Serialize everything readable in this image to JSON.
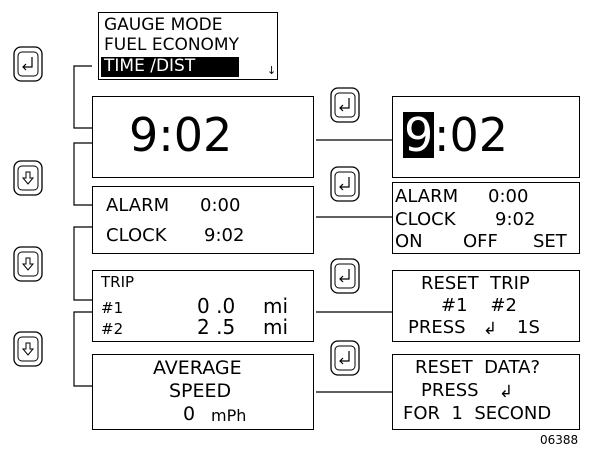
{
  "menu": {
    "line1": "GAUGE MODE",
    "line2": "FUEL ECONOMY",
    "line3": "TIME /DIST",
    "scroll_glyph": "↓"
  },
  "clock": {
    "time": "9:02"
  },
  "clock_edit": {
    "hour_digit": "9",
    "rest": ":02"
  },
  "alarm_clock": {
    "alarm_label": "ALARM",
    "alarm_value": "0:00",
    "clock_label": "CLOCK",
    "clock_value": "9:02"
  },
  "alarm_clock_edit": {
    "alarm_label": "ALARM",
    "alarm_value": "0:00",
    "clock_label": "CLOCK",
    "clock_value": "9:02",
    "opt_on": "ON",
    "opt_off": "OFF",
    "opt_set": "SET"
  },
  "trip": {
    "title": "TRIP",
    "trip1_label": "#1",
    "trip1_value": "0 .0",
    "trip1_unit": "mi",
    "trip2_label": "#2",
    "trip2_value": "2 .5",
    "trip2_unit": "mi"
  },
  "reset_trip": {
    "title": "RESET  TRIP",
    "options": "#1    #2",
    "press": "PRESS",
    "enter_glyph": "↲",
    "duration": "1S"
  },
  "avg_speed": {
    "line1": "AVERAGE",
    "line2": "SPEED",
    "value": "0",
    "unit": "mPh"
  },
  "reset_data": {
    "line1": "RESET  DATA?",
    "press": "PRESS",
    "enter_glyph": "↲",
    "line3": "FOR  1  SECOND"
  },
  "figure_id": "06388",
  "icons": {
    "enter_button": "enter-icon",
    "down_button": "down-arrow-icon"
  }
}
